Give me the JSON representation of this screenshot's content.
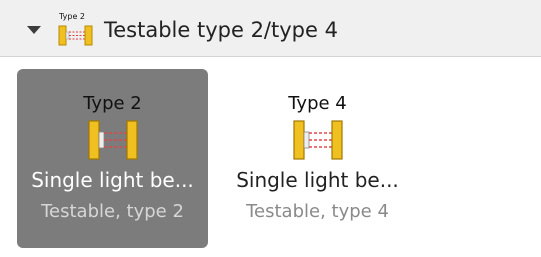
{
  "group": {
    "title": "Testable type 2/type 4",
    "icon_label": "Type 2",
    "icon": "light-beam-icon",
    "expanded": true
  },
  "tiles": [
    {
      "type_label": "Type 2",
      "name": "Single light be...",
      "subtitle": "Testable, type 2",
      "icon": "light-beam-icon",
      "selected": true
    },
    {
      "type_label": "Type 4",
      "name": "Single light be...",
      "subtitle": "Testable, type 4",
      "icon": "light-beam-icon",
      "selected": false
    }
  ],
  "colors": {
    "header_background": "#f0f0f0",
    "selected_tile": "#7c7c7c",
    "device_body": "#f0c020",
    "beam": "#e04040"
  }
}
